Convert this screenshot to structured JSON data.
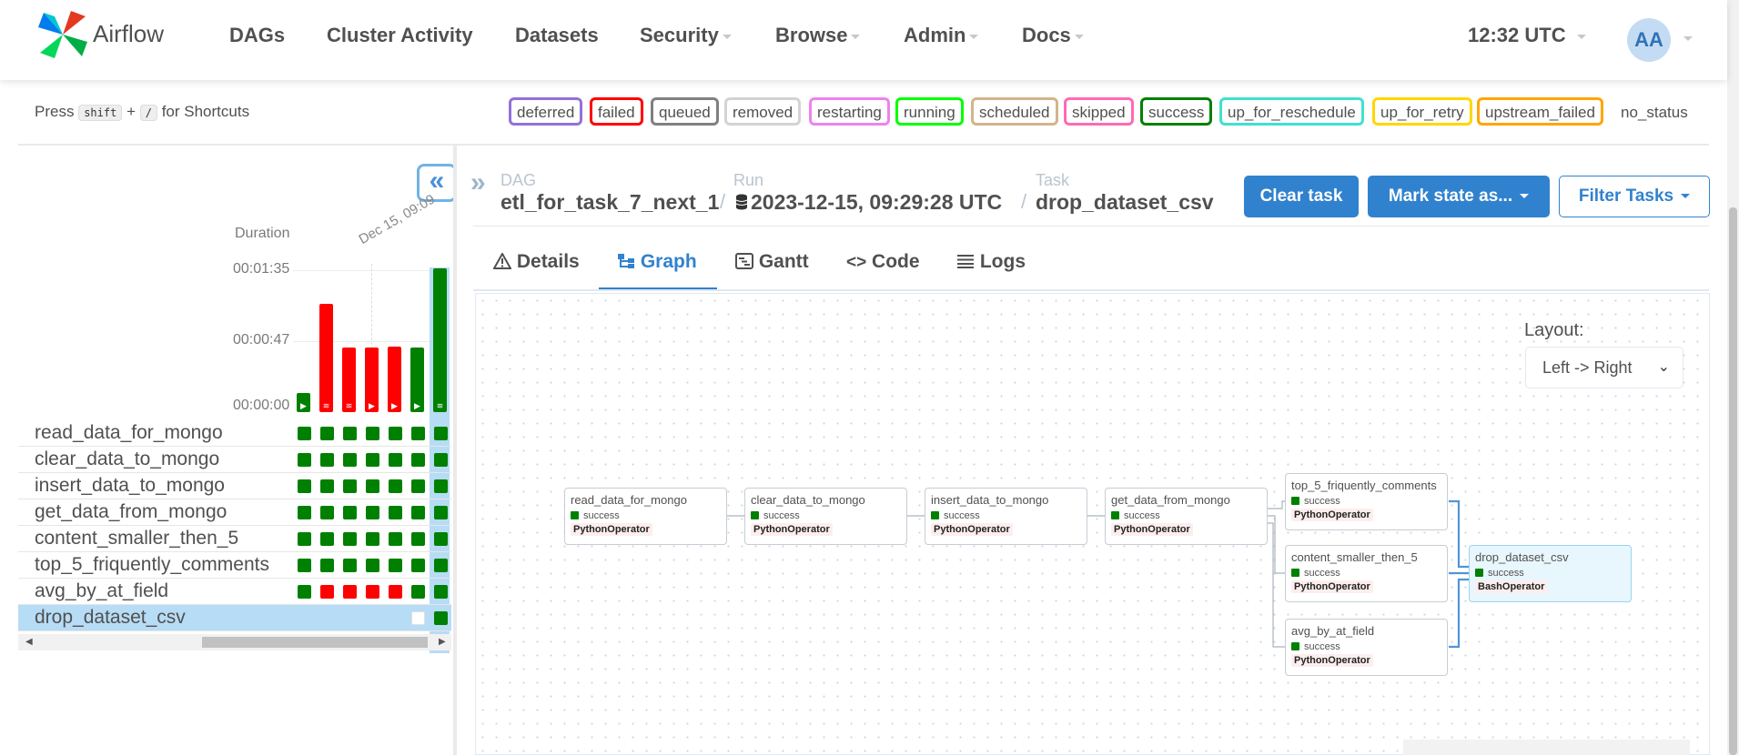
{
  "navbar": {
    "brand": "Airflow",
    "items": [
      {
        "label": "DAGs",
        "dropdown": false
      },
      {
        "label": "Cluster Activity",
        "dropdown": false
      },
      {
        "label": "Datasets",
        "dropdown": false
      },
      {
        "label": "Security",
        "dropdown": true
      },
      {
        "label": "Browse",
        "dropdown": true
      },
      {
        "label": "Admin",
        "dropdown": true
      },
      {
        "label": "Docs",
        "dropdown": true
      }
    ],
    "clock": "12:32 UTC",
    "avatar_initials": "AA"
  },
  "shortcuts": {
    "press": "Press",
    "key1": "shift",
    "plus": "+",
    "key2": "/",
    "suffix": "for Shortcuts"
  },
  "legend": [
    {
      "label": "deferred",
      "color": "#9370db"
    },
    {
      "label": "failed",
      "color": "#ff0000"
    },
    {
      "label": "queued",
      "color": "#808080"
    },
    {
      "label": "removed",
      "color": "#d3d3d3"
    },
    {
      "label": "restarting",
      "color": "#ee82ee"
    },
    {
      "label": "running",
      "color": "#00ff00"
    },
    {
      "label": "scheduled",
      "color": "#d2b48c"
    },
    {
      "label": "skipped",
      "color": "#ff69b4"
    },
    {
      "label": "success",
      "color": "#008000"
    },
    {
      "label": "up_for_reschedule",
      "color": "#40e0d0"
    },
    {
      "label": "up_for_retry",
      "color": "#ffd700"
    },
    {
      "label": "upstream_failed",
      "color": "#ffa500"
    },
    {
      "label": "no_status",
      "color": ""
    }
  ],
  "grid": {
    "collapse_icon": "«",
    "duration_label": "Duration",
    "date_label": "Dec 15, 09:09",
    "ticks": [
      "00:01:35",
      "00:00:47",
      "00:00:00"
    ],
    "runs": [
      {
        "state": "success",
        "duration_s": 13,
        "icon": "play-icon"
      },
      {
        "state": "failed",
        "duration_s": 74,
        "icon": "database-icon"
      },
      {
        "state": "failed",
        "duration_s": 44,
        "icon": "database-icon"
      },
      {
        "state": "failed",
        "duration_s": 44,
        "icon": "play-icon"
      },
      {
        "state": "failed",
        "duration_s": 45,
        "icon": "play-icon"
      },
      {
        "state": "success",
        "duration_s": 44,
        "icon": "play-icon"
      },
      {
        "state": "success",
        "duration_s": 98,
        "icon": "database-icon"
      }
    ],
    "tasks": [
      {
        "name": "read_data_for_mongo",
        "states": [
          "success",
          "success",
          "success",
          "success",
          "success",
          "success",
          "success"
        ]
      },
      {
        "name": "clear_data_to_mongo",
        "states": [
          "success",
          "success",
          "success",
          "success",
          "success",
          "success",
          "success"
        ]
      },
      {
        "name": "insert_data_to_mongo",
        "states": [
          "success",
          "success",
          "success",
          "success",
          "success",
          "success",
          "success"
        ]
      },
      {
        "name": "get_data_from_mongo",
        "states": [
          "success",
          "success",
          "success",
          "success",
          "success",
          "success",
          "success"
        ]
      },
      {
        "name": "content_smaller_then_5",
        "states": [
          "success",
          "success",
          "success",
          "success",
          "success",
          "success",
          "success"
        ]
      },
      {
        "name": "top_5_friquently_comments",
        "states": [
          "success",
          "success",
          "success",
          "success",
          "success",
          "success",
          "success"
        ]
      },
      {
        "name": "avg_by_at_field",
        "states": [
          "success",
          "failed",
          "failed",
          "failed",
          "failed",
          "success",
          "success"
        ]
      },
      {
        "name": "drop_dataset_csv",
        "states": [
          "none",
          "none",
          "none",
          "none",
          "none",
          "no_status",
          "success"
        ]
      }
    ],
    "selected_task": "drop_dataset_csv"
  },
  "breadcrumb": {
    "dag_label": "DAG",
    "dag_value": "etl_for_task_7_next_1",
    "run_label": "Run",
    "run_value": "2023-12-15, 09:29:28 UTC",
    "task_label": "Task",
    "task_value": "drop_dataset_csv",
    "separator": "/"
  },
  "actions": {
    "clear_task": "Clear task",
    "mark_state": "Mark state as...",
    "filter_tasks": "Filter Tasks"
  },
  "tabs": [
    {
      "label": "Details",
      "icon": "warning-icon",
      "active": false
    },
    {
      "label": "Graph",
      "icon": "graph-icon",
      "active": true
    },
    {
      "label": "Gantt",
      "icon": "gantt-icon",
      "active": false
    },
    {
      "label": "Code",
      "icon": "code-icon",
      "active": false
    },
    {
      "label": "Logs",
      "icon": "list-icon",
      "active": false
    }
  ],
  "graph": {
    "layout_label": "Layout:",
    "layout_value": "Left -> Right",
    "nodes": [
      {
        "name": "read_data_for_mongo",
        "state": "success",
        "operator": "PythonOperator"
      },
      {
        "name": "clear_data_to_mongo",
        "state": "success",
        "operator": "PythonOperator"
      },
      {
        "name": "insert_data_to_mongo",
        "state": "success",
        "operator": "PythonOperator"
      },
      {
        "name": "get_data_from_mongo",
        "state": "success",
        "operator": "PythonOperator"
      },
      {
        "name": "top_5_friquently_comments",
        "state": "success",
        "operator": "PythonOperator"
      },
      {
        "name": "content_smaller_then_5",
        "state": "success",
        "operator": "PythonOperator"
      },
      {
        "name": "avg_by_at_field",
        "state": "success",
        "operator": "PythonOperator"
      },
      {
        "name": "drop_dataset_csv",
        "state": "success",
        "operator": "BashOperator"
      }
    ]
  },
  "colors": {
    "success": "#008000",
    "failed": "#ff0000",
    "accent": "#3182ce"
  }
}
